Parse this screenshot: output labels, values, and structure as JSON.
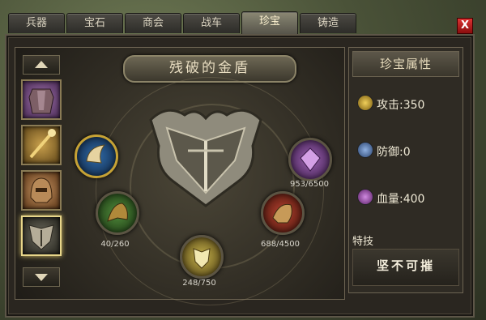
{
  "tabs": [
    {
      "label": "兵器",
      "active": false
    },
    {
      "label": "宝石",
      "active": false
    },
    {
      "label": "商会",
      "active": false
    },
    {
      "label": "战车",
      "active": false
    },
    {
      "label": "珍宝",
      "active": true
    },
    {
      "label": "铸造",
      "active": false
    }
  ],
  "close_label": "X",
  "item_title": "残破的金盾",
  "slots": [
    {
      "name": "armor",
      "selected": false
    },
    {
      "name": "staff",
      "selected": false
    },
    {
      "name": "helmet",
      "selected": false
    },
    {
      "name": "shield",
      "selected": true
    }
  ],
  "orbs": [
    {
      "name": "horn-orb",
      "progress": ""
    },
    {
      "name": "purple-gem-orb",
      "progress": "953/6500"
    },
    {
      "name": "green-beast-orb",
      "progress": "40/260"
    },
    {
      "name": "red-beast-orb",
      "progress": "688/4500"
    },
    {
      "name": "gold-shield-orb",
      "progress": "248/750"
    }
  ],
  "attributes": {
    "header": "珍宝属性",
    "stats": [
      {
        "label": "攻击:350",
        "icon": "sword-icon",
        "color": "#d6a629"
      },
      {
        "label": "防御:0",
        "icon": "shield-icon",
        "color": "#5d83c2"
      },
      {
        "label": "血量:400",
        "icon": "heart-icon",
        "color": "#a24fb0"
      }
    ],
    "skill_header": "特技",
    "skill_name": "坚不可摧"
  }
}
